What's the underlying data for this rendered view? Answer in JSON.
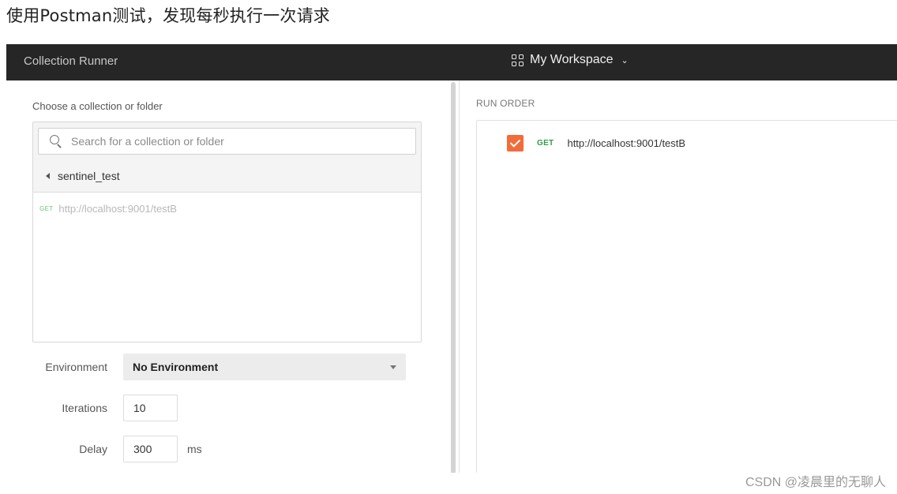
{
  "caption": "使用Postman测试，发现每秒执行一次请求",
  "window": {
    "title": "Collection Runner",
    "workspace": {
      "label": "My Workspace",
      "icon": "grid-icon",
      "chevron": "chevron-down-icon"
    }
  },
  "left_panel": {
    "choose_label": "Choose a collection or folder",
    "search": {
      "placeholder": "Search for a collection or folder",
      "value": ""
    },
    "folder": {
      "name": "sentinel_test",
      "icon": "back-arrow-icon"
    },
    "requests": [
      {
        "method": "GET",
        "url": "http://localhost:9001/testB"
      }
    ],
    "environment": {
      "label": "Environment",
      "value": "No Environment"
    },
    "iterations": {
      "label": "Iterations",
      "value": "10"
    },
    "delay": {
      "label": "Delay",
      "value": "300",
      "unit": "ms"
    }
  },
  "right_panel": {
    "run_order_label": "RUN ORDER",
    "items": [
      {
        "checked": true,
        "method": "GET",
        "url": "http://localhost:9001/testB"
      }
    ]
  },
  "colors": {
    "accent": "#f26b3a",
    "get_method": "#2e9e4a",
    "titlebar": "#262626"
  },
  "watermark": "CSDN @凌晨里的无聊人"
}
